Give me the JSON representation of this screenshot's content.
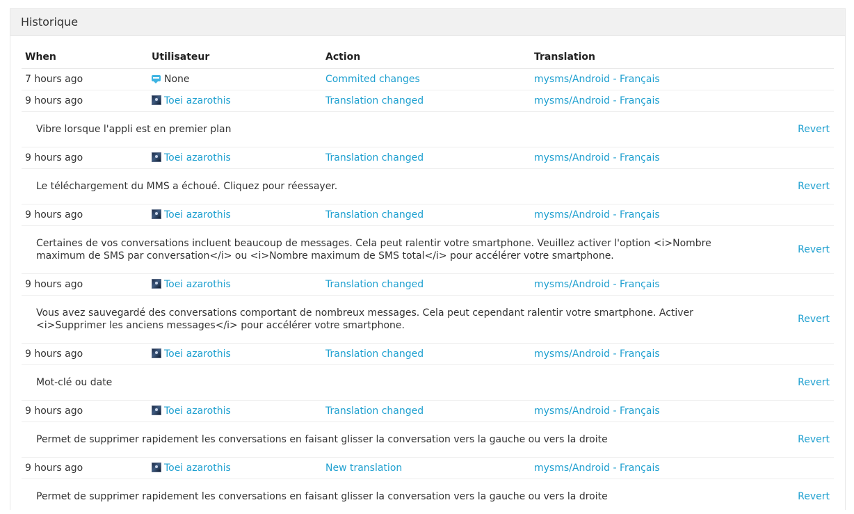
{
  "panel": {
    "title": "Historique"
  },
  "columns": [
    "When",
    "Utilisateur",
    "Action",
    "Translation"
  ],
  "revert_label": "Revert",
  "entries": [
    {
      "when": "7 hours ago",
      "user": "None",
      "user_icon": "robot-icon",
      "action": "Commited changes",
      "translation": "mysms/Android - Français",
      "detail": null
    },
    {
      "when": "9 hours ago",
      "user": "Toei azarothis",
      "user_icon": "avatar",
      "action": "Translation changed",
      "translation": "mysms/Android - Français",
      "detail": "Vibre lorsque l'appli est en premier plan"
    },
    {
      "when": "9 hours ago",
      "user": "Toei azarothis",
      "user_icon": "avatar",
      "action": "Translation changed",
      "translation": "mysms/Android - Français",
      "detail": "Le téléchargement du MMS a échoué. Cliquez pour réessayer."
    },
    {
      "when": "9 hours ago",
      "user": "Toei azarothis",
      "user_icon": "avatar",
      "action": "Translation changed",
      "translation": "mysms/Android - Français",
      "detail": "Certaines de vos conversations incluent beaucoup de messages. Cela peut ralentir votre smartphone. Veuillez activer l'option <i>Nombre maximum de SMS par conversation</i> ou <i>Nombre maximum de SMS total</i> pour accélérer votre smartphone."
    },
    {
      "when": "9 hours ago",
      "user": "Toei azarothis",
      "user_icon": "avatar",
      "action": "Translation changed",
      "translation": "mysms/Android - Français",
      "detail": "Vous avez sauvegardé des conversations comportant de nombreux messages. Cela peut cependant ralentir votre smartphone. Activer <i>Supprimer les anciens messages</i> pour accélérer votre smartphone."
    },
    {
      "when": "9 hours ago",
      "user": "Toei azarothis",
      "user_icon": "avatar",
      "action": "Translation changed",
      "translation": "mysms/Android - Français",
      "detail": "Mot-clé ou date"
    },
    {
      "when": "9 hours ago",
      "user": "Toei azarothis",
      "user_icon": "avatar",
      "action": "Translation changed",
      "translation": "mysms/Android - Français",
      "detail": "Permet de supprimer rapidement les conversations en faisant glisser la conversation vers la gauche ou vers la droite"
    },
    {
      "when": "9 hours ago",
      "user": "Toei azarothis",
      "user_icon": "avatar",
      "action": "New translation",
      "translation": "mysms/Android - Français",
      "detail": "Permet de supprimer rapidement les conversations en faisant glisser la conversation vers la gauche ou vers la droite"
    }
  ],
  "colors": {
    "link": "#1fa0d0",
    "heading_bg": "#f1f1f1"
  }
}
